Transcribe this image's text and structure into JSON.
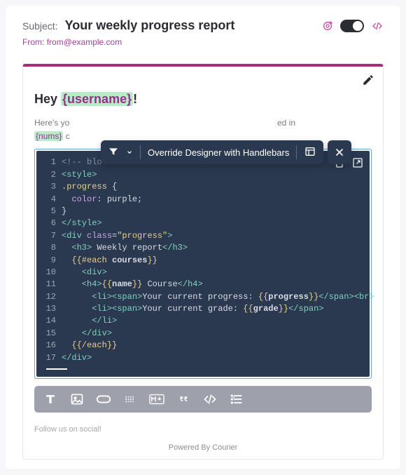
{
  "header": {
    "subject_label": "Subject:",
    "subject_value": "Your weekly progress report",
    "from_label": "From:",
    "from_value": "from@example.com"
  },
  "toolbar": {
    "override_label": "Override Designer with Handlebars"
  },
  "content": {
    "greeting_prefix": "Hey ",
    "greeting_var": "{username}",
    "greeting_suffix": "!",
    "body_line1_a": "Here's yo",
    "body_line1_b": "ed in",
    "body_line2_var": "{nums}",
    "body_line2_suffix": " c"
  },
  "code": {
    "lines": [
      {
        "n": "1",
        "segs": [
          {
            "c": "t-comment",
            "t": "<!-- block title -->"
          }
        ]
      },
      {
        "n": "2",
        "segs": [
          {
            "c": "t-tag",
            "t": "<style>"
          }
        ]
      },
      {
        "n": "3",
        "segs": [
          {
            "c": "t-sel",
            "t": ".progress "
          },
          {
            "c": "t-close",
            "t": "{"
          }
        ]
      },
      {
        "n": "4",
        "segs": [
          {
            "c": "t-text",
            "t": "  "
          },
          {
            "c": "t-prop",
            "t": "color"
          },
          {
            "c": "t-close",
            "t": ": purple;"
          }
        ]
      },
      {
        "n": "5",
        "segs": [
          {
            "c": "t-close",
            "t": "}"
          }
        ]
      },
      {
        "n": "6",
        "segs": [
          {
            "c": "t-tag",
            "t": "</style>"
          }
        ]
      },
      {
        "n": "7",
        "segs": [
          {
            "c": "t-tag",
            "t": "<div "
          },
          {
            "c": "t-attr",
            "t": "class"
          },
          {
            "c": "t-close",
            "t": "="
          },
          {
            "c": "t-str",
            "t": "\"progress\""
          },
          {
            "c": "t-tag",
            "t": ">"
          }
        ]
      },
      {
        "n": "8",
        "segs": [
          {
            "c": "t-text",
            "t": "  "
          },
          {
            "c": "t-tag",
            "t": "<h3>"
          },
          {
            "c": "t-text",
            "t": " Weekly report"
          },
          {
            "c": "t-tag",
            "t": "</h3>"
          }
        ]
      },
      {
        "n": "9",
        "segs": [
          {
            "c": "t-text",
            "t": "  "
          },
          {
            "c": "t-hbs",
            "t": "{{#each "
          },
          {
            "c": "t-hbsvar",
            "t": "courses"
          },
          {
            "c": "t-hbs",
            "t": "}}"
          }
        ]
      },
      {
        "n": "10",
        "segs": [
          {
            "c": "t-text",
            "t": "    "
          },
          {
            "c": "t-tag",
            "t": "<div>"
          }
        ]
      },
      {
        "n": "11",
        "segs": [
          {
            "c": "t-text",
            "t": "    "
          },
          {
            "c": "t-tag",
            "t": "<h4>"
          },
          {
            "c": "t-hbs",
            "t": "{{"
          },
          {
            "c": "t-hbsvar",
            "t": "name"
          },
          {
            "c": "t-hbs",
            "t": "}}"
          },
          {
            "c": "t-text",
            "t": " Course"
          },
          {
            "c": "t-tag",
            "t": "</h4>"
          }
        ]
      },
      {
        "n": "12",
        "segs": [
          {
            "c": "t-text",
            "t": "      "
          },
          {
            "c": "t-tag",
            "t": "<li><span>"
          },
          {
            "c": "t-text",
            "t": "Your current progress: "
          },
          {
            "c": "t-hbs",
            "t": "{{"
          },
          {
            "c": "t-hbsvar",
            "t": "progress"
          },
          {
            "c": "t-hbs",
            "t": "}}"
          },
          {
            "c": "t-tag",
            "t": "</span><br>"
          }
        ]
      },
      {
        "n": "13",
        "segs": [
          {
            "c": "t-text",
            "t": "      "
          },
          {
            "c": "t-tag",
            "t": "<li><span>"
          },
          {
            "c": "t-text",
            "t": "Your current grade: "
          },
          {
            "c": "t-hbs",
            "t": "{{"
          },
          {
            "c": "t-hbsvar",
            "t": "grade"
          },
          {
            "c": "t-hbs",
            "t": "}}"
          },
          {
            "c": "t-tag",
            "t": "</span>"
          }
        ]
      },
      {
        "n": "14",
        "segs": [
          {
            "c": "t-text",
            "t": "      "
          },
          {
            "c": "t-tag",
            "t": "</li>"
          }
        ]
      },
      {
        "n": "15",
        "segs": [
          {
            "c": "t-text",
            "t": "    "
          },
          {
            "c": "t-tag",
            "t": "</div>"
          }
        ]
      },
      {
        "n": "16",
        "segs": [
          {
            "c": "t-text",
            "t": "  "
          },
          {
            "c": "t-hbs",
            "t": "{{/each}}"
          }
        ]
      },
      {
        "n": "17",
        "segs": [
          {
            "c": "t-tag",
            "t": "</div>"
          }
        ]
      }
    ]
  },
  "footer": {
    "follow": "Follow us on social!",
    "powered": "Powered By Courier"
  }
}
